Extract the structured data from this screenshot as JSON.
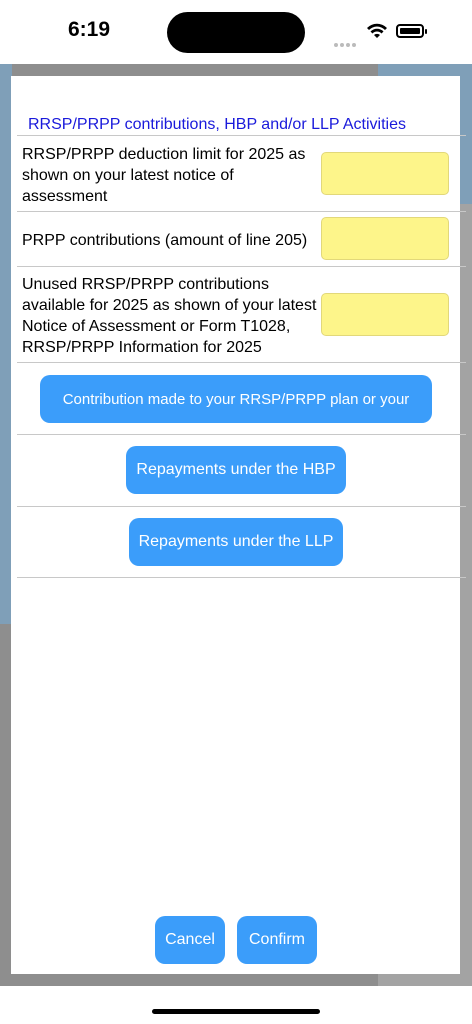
{
  "status_bar": {
    "time": "6:19"
  },
  "modal": {
    "section_title": "RRSP/PRPP contributions, HBP and/or LLP Activities",
    "rows": [
      {
        "label": "RRSP/PRPP deduction limit for 2025 as shown on your latest notice of assessment",
        "value": ""
      },
      {
        "label": "PRPP contributions (amount of line 205)",
        "value": ""
      },
      {
        "label": "Unused RRSP/PRPP contributions available for 2025 as shown of your latest Notice of Assessment or Form T1028, RRSP/PRPP Information for 2025",
        "value": ""
      }
    ],
    "buttons": {
      "contribution": "Contribution made to your RRSP/PRPP plan or your",
      "hbp": "Repayments under the HBP",
      "llp": "Repayments under the LLP",
      "cancel": "Cancel",
      "confirm": "Confirm"
    }
  },
  "colors": {
    "accent": "#3b9dfa",
    "title_text": "#1a1adb",
    "input_fill": "#fdf58a"
  }
}
